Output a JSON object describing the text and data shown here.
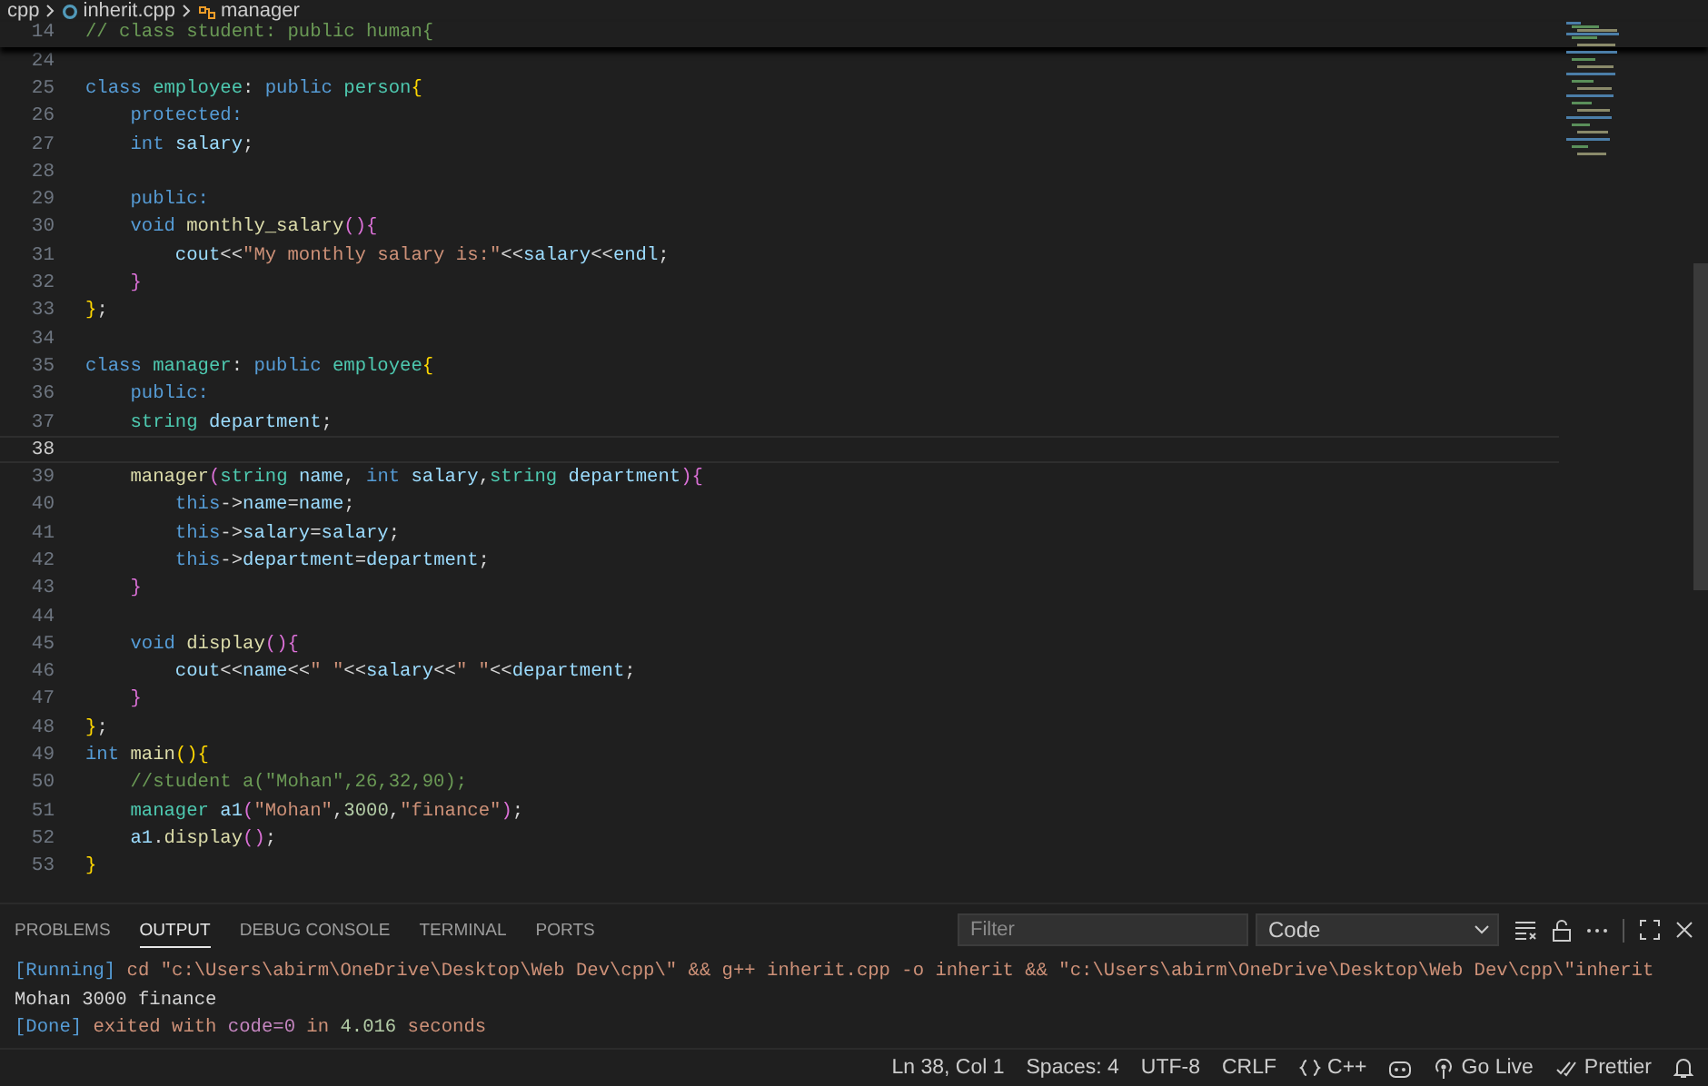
{
  "breadcrumb": [
    {
      "kind": "folder",
      "label": "cpp"
    },
    {
      "kind": "file",
      "label": "inherit.cpp"
    },
    {
      "kind": "class",
      "label": "manager"
    }
  ],
  "sticky_line": {
    "no": "14",
    "tokens": [
      {
        "kind": "comment",
        "text": "// class student: public human{"
      }
    ]
  },
  "lines": [
    {
      "no": "24",
      "current": false
    },
    {
      "no": "25",
      "current": false,
      "tokens": [
        {
          "kind": "keyword",
          "text": "class "
        },
        {
          "kind": "type",
          "text": "employee"
        },
        {
          "kind": "punct",
          "text": ": "
        },
        {
          "kind": "keyword",
          "text": "public "
        },
        {
          "kind": "type",
          "text": "person"
        },
        {
          "kind": "bracket1",
          "text": "{"
        }
      ]
    },
    {
      "no": "26",
      "current": false,
      "tokens": [
        {
          "kind": "keyword",
          "text": "    protected:"
        }
      ]
    },
    {
      "no": "27",
      "current": false,
      "tokens": [
        {
          "kind": "keyword",
          "text": "    int "
        },
        {
          "kind": "variable",
          "text": "salary"
        },
        {
          "kind": "punct",
          "text": ";"
        }
      ]
    },
    {
      "no": "28",
      "current": false
    },
    {
      "no": "29",
      "current": false,
      "tokens": [
        {
          "kind": "keyword",
          "text": "    public:"
        }
      ]
    },
    {
      "no": "30",
      "current": false,
      "tokens": [
        {
          "kind": "keyword",
          "text": "    void "
        },
        {
          "kind": "function",
          "text": "monthly_salary"
        },
        {
          "kind": "bracket2",
          "text": "(){"
        }
      ]
    },
    {
      "no": "31",
      "current": false,
      "tokens": [
        {
          "kind": "variable",
          "text": "        cout"
        },
        {
          "kind": "punct",
          "text": "<<"
        },
        {
          "kind": "string",
          "text": "\"My monthly salary is:\""
        },
        {
          "kind": "punct",
          "text": "<<"
        },
        {
          "kind": "variable",
          "text": "salary"
        },
        {
          "kind": "punct",
          "text": "<<"
        },
        {
          "kind": "variable",
          "text": "endl"
        },
        {
          "kind": "punct",
          "text": ";"
        }
      ]
    },
    {
      "no": "32",
      "current": false,
      "tokens": [
        {
          "kind": "bracket2",
          "text": "    }"
        }
      ]
    },
    {
      "no": "33",
      "current": false,
      "tokens": [
        {
          "kind": "bracket1",
          "text": "}"
        },
        {
          "kind": "punct",
          "text": ";"
        }
      ]
    },
    {
      "no": "34",
      "current": false
    },
    {
      "no": "35",
      "current": false,
      "tokens": [
        {
          "kind": "keyword",
          "text": "class "
        },
        {
          "kind": "type",
          "text": "manager"
        },
        {
          "kind": "punct",
          "text": ": "
        },
        {
          "kind": "keyword",
          "text": "public "
        },
        {
          "kind": "type",
          "text": "employee"
        },
        {
          "kind": "bracket1",
          "text": "{"
        }
      ]
    },
    {
      "no": "36",
      "current": false,
      "tokens": [
        {
          "kind": "keyword",
          "text": "    public:"
        }
      ]
    },
    {
      "no": "37",
      "current": false,
      "tokens": [
        {
          "kind": "type",
          "text": "    string "
        },
        {
          "kind": "variable",
          "text": "department"
        },
        {
          "kind": "punct",
          "text": ";"
        }
      ]
    },
    {
      "no": "38",
      "current": true
    },
    {
      "no": "39",
      "current": false,
      "tokens": [
        {
          "kind": "function",
          "text": "    manager"
        },
        {
          "kind": "bracket2",
          "text": "("
        },
        {
          "kind": "type",
          "text": "string "
        },
        {
          "kind": "variable",
          "text": "name"
        },
        {
          "kind": "punct",
          "text": ", "
        },
        {
          "kind": "keyword",
          "text": "int "
        },
        {
          "kind": "variable",
          "text": "salary"
        },
        {
          "kind": "punct",
          "text": ","
        },
        {
          "kind": "type",
          "text": "string "
        },
        {
          "kind": "variable",
          "text": "department"
        },
        {
          "kind": "bracket2",
          "text": "){"
        }
      ]
    },
    {
      "no": "40",
      "current": false,
      "tokens": [
        {
          "kind": "keyword",
          "text": "        this"
        },
        {
          "kind": "punct",
          "text": "->"
        },
        {
          "kind": "variable",
          "text": "name"
        },
        {
          "kind": "punct",
          "text": "="
        },
        {
          "kind": "variable",
          "text": "name"
        },
        {
          "kind": "punct",
          "text": ";"
        }
      ]
    },
    {
      "no": "41",
      "current": false,
      "tokens": [
        {
          "kind": "keyword",
          "text": "        this"
        },
        {
          "kind": "punct",
          "text": "->"
        },
        {
          "kind": "variable",
          "text": "salary"
        },
        {
          "kind": "punct",
          "text": "="
        },
        {
          "kind": "variable",
          "text": "salary"
        },
        {
          "kind": "punct",
          "text": ";"
        }
      ]
    },
    {
      "no": "42",
      "current": false,
      "tokens": [
        {
          "kind": "keyword",
          "text": "        this"
        },
        {
          "kind": "punct",
          "text": "->"
        },
        {
          "kind": "variable",
          "text": "department"
        },
        {
          "kind": "punct",
          "text": "="
        },
        {
          "kind": "variable",
          "text": "department"
        },
        {
          "kind": "punct",
          "text": ";"
        }
      ]
    },
    {
      "no": "43",
      "current": false,
      "tokens": [
        {
          "kind": "bracket2",
          "text": "    }"
        }
      ]
    },
    {
      "no": "44",
      "current": false
    },
    {
      "no": "45",
      "current": false,
      "tokens": [
        {
          "kind": "keyword",
          "text": "    void "
        },
        {
          "kind": "function",
          "text": "display"
        },
        {
          "kind": "bracket2",
          "text": "(){"
        }
      ]
    },
    {
      "no": "46",
      "current": false,
      "tokens": [
        {
          "kind": "variable",
          "text": "        cout"
        },
        {
          "kind": "punct",
          "text": "<<"
        },
        {
          "kind": "variable",
          "text": "name"
        },
        {
          "kind": "punct",
          "text": "<<"
        },
        {
          "kind": "string",
          "text": "\" \""
        },
        {
          "kind": "punct",
          "text": "<<"
        },
        {
          "kind": "variable",
          "text": "salary"
        },
        {
          "kind": "punct",
          "text": "<<"
        },
        {
          "kind": "string",
          "text": "\" \""
        },
        {
          "kind": "punct",
          "text": "<<"
        },
        {
          "kind": "variable",
          "text": "department"
        },
        {
          "kind": "punct",
          "text": ";"
        }
      ]
    },
    {
      "no": "47",
      "current": false,
      "tokens": [
        {
          "kind": "bracket2",
          "text": "    }"
        }
      ]
    },
    {
      "no": "48",
      "current": false,
      "tokens": [
        {
          "kind": "bracket1",
          "text": "}"
        },
        {
          "kind": "punct",
          "text": ";"
        }
      ]
    },
    {
      "no": "49",
      "current": false,
      "tokens": [
        {
          "kind": "keyword",
          "text": "int "
        },
        {
          "kind": "function",
          "text": "main"
        },
        {
          "kind": "bracket1",
          "text": "(){"
        }
      ]
    },
    {
      "no": "50",
      "current": false,
      "tokens": [
        {
          "kind": "comment",
          "text": "    //student a(\"Mohan\",26,32,90);"
        }
      ]
    },
    {
      "no": "51",
      "current": false,
      "tokens": [
        {
          "kind": "type",
          "text": "    manager "
        },
        {
          "kind": "variable",
          "text": "a1"
        },
        {
          "kind": "bracket2",
          "text": "("
        },
        {
          "kind": "string",
          "text": "\"Mohan\""
        },
        {
          "kind": "punct",
          "text": ","
        },
        {
          "kind": "number",
          "text": "3000"
        },
        {
          "kind": "punct",
          "text": ","
        },
        {
          "kind": "string",
          "text": "\"finance\""
        },
        {
          "kind": "bracket2",
          "text": ")"
        },
        {
          "kind": "punct",
          "text": ";"
        }
      ]
    },
    {
      "no": "52",
      "current": false,
      "tokens": [
        {
          "kind": "variable",
          "text": "    a1"
        },
        {
          "kind": "punct",
          "text": "."
        },
        {
          "kind": "function",
          "text": "display"
        },
        {
          "kind": "bracket2",
          "text": "()"
        },
        {
          "kind": "punct",
          "text": ";"
        }
      ]
    },
    {
      "no": "53",
      "current": false,
      "tokens": [
        {
          "kind": "bracket1",
          "text": "}"
        }
      ]
    }
  ],
  "panel": {
    "tabs": [
      {
        "label": "PROBLEMS",
        "selected": false
      },
      {
        "label": "OUTPUT",
        "selected": true
      },
      {
        "label": "DEBUG CONSOLE",
        "selected": false
      },
      {
        "label": "TERMINAL",
        "selected": false
      },
      {
        "label": "PORTS",
        "selected": false
      }
    ],
    "filter": {
      "placeholder": "Filter"
    },
    "channel": "Code",
    "output": [
      [
        {
          "kind": "keyword",
          "text": "[Running]"
        },
        {
          "kind": "string",
          "text": " cd \"c:\\Users\\abirm\\OneDrive\\Desktop\\Web Dev\\cpp\\\" && g++ inherit.cpp -o inherit && \"c:\\Users\\abirm\\OneDrive\\Desktop\\Web Dev\\cpp\\\"inherit"
        }
      ],
      [
        {
          "kind": "punct",
          "text": "Mohan 3000 finance"
        }
      ],
      [
        {
          "kind": "keyword",
          "text": "[Done]"
        },
        {
          "kind": "string",
          "text": " exited with "
        },
        {
          "kind": "magenta",
          "text": "code=0"
        },
        {
          "kind": "string",
          "text": " in "
        },
        {
          "kind": "number",
          "text": "4.016"
        },
        {
          "kind": "string",
          "text": " seconds"
        }
      ]
    ]
  },
  "status_bar": [
    {
      "kind": "text",
      "label": "Ln 38, Col 1"
    },
    {
      "kind": "text",
      "label": "Spaces: 4"
    },
    {
      "kind": "text",
      "label": "UTF-8"
    },
    {
      "kind": "text",
      "label": "CRLF"
    },
    {
      "kind": "language",
      "label": "C++"
    },
    {
      "kind": "copilot"
    },
    {
      "kind": "live",
      "label": "Go Live"
    },
    {
      "kind": "prettier",
      "label": "Prettier"
    },
    {
      "kind": "bell"
    }
  ]
}
